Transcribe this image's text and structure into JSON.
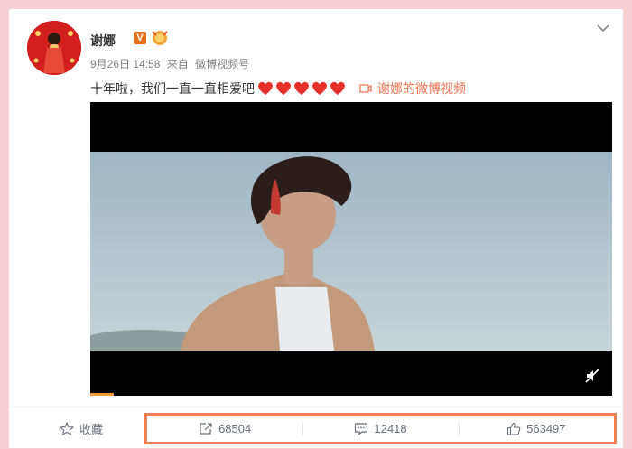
{
  "post": {
    "username": "谢娜",
    "verified_badge": "V",
    "date": "9月26日 14:58",
    "source_prefix": "来自",
    "source": "微博视频号",
    "text": "十年啦，我们一直一直相爱吧",
    "heart_count": 5,
    "video_link_label": "谢娜的微博视频"
  },
  "actions": {
    "favorite_label": "收藏",
    "repost_count": "68504",
    "comment_count": "12418",
    "like_count": "563497"
  },
  "colors": {
    "page_bg": "#f6d0d4",
    "accent_orange": "#eb7350",
    "highlight_box": "#f08050",
    "heart": "#e8302b"
  },
  "icons": [
    "chevron-down-icon",
    "medal-icon",
    "heart-icon",
    "video-icon",
    "mute-icon",
    "star-icon",
    "repost-icon",
    "comment-icon",
    "like-icon"
  ]
}
